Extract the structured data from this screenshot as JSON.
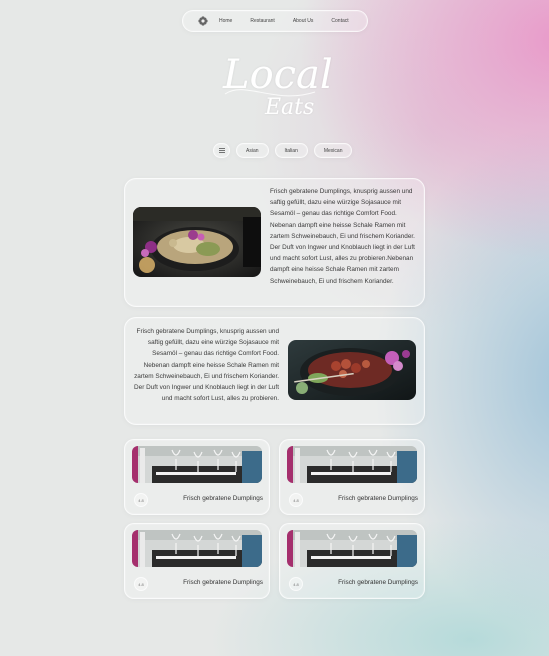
{
  "nav": {
    "logo_icon": "flower-icon",
    "links": [
      "Home",
      "Restaurant",
      "About Us",
      "Contact"
    ]
  },
  "brand": {
    "line1": "Local",
    "line2": "Eats"
  },
  "filters": {
    "menu_icon": "list-icon",
    "chips": [
      "Asian",
      "Italian",
      "Mexican"
    ]
  },
  "feature_cards": [
    {
      "text": "Frisch gebratene Dumplings, knusprig aussen und saftig gefüllt, dazu eine würzige Sojasauce mit Sesamöl – genau das richtige Comfort Food. Nebenan dampft eine heisse Schale Ramen mit zartem Schweinebauch, Ei und frischem Koriander. Der Duft von Ingwer und Knoblauch liegt in der Luft und macht sofort Lust, alles zu probieren.Nebenan dampft eine heisse Schale Ramen mit zartem Schweinebauch, Ei und frischem Koriander.",
      "image": "noodle-bowl-photo"
    },
    {
      "text": "Frisch gebratene Dumplings, knusprig aussen und saftig gefüllt, dazu eine würzige Sojasauce mit Sesamöl – genau das richtige Comfort Food. Nebenan dampft eine heisse Schale Ramen mit zartem Schweinebauch, Ei und frischem Koriander. Der Duft von Ingwer und Knoblauch liegt in der Luft und macht sofort Lust, alles zu probieren.",
      "image": "poke-bowl-photo"
    }
  ],
  "mini_cards": [
    {
      "rating": "4.8",
      "title": "Frisch gebratene Dumplings"
    },
    {
      "rating": "4.8",
      "title": "Frisch gebratene Dumplings"
    },
    {
      "rating": "4.8",
      "title": "Frisch gebratene Dumplings"
    },
    {
      "rating": "4.8",
      "title": "Frisch gebratene Dumplings"
    }
  ]
}
